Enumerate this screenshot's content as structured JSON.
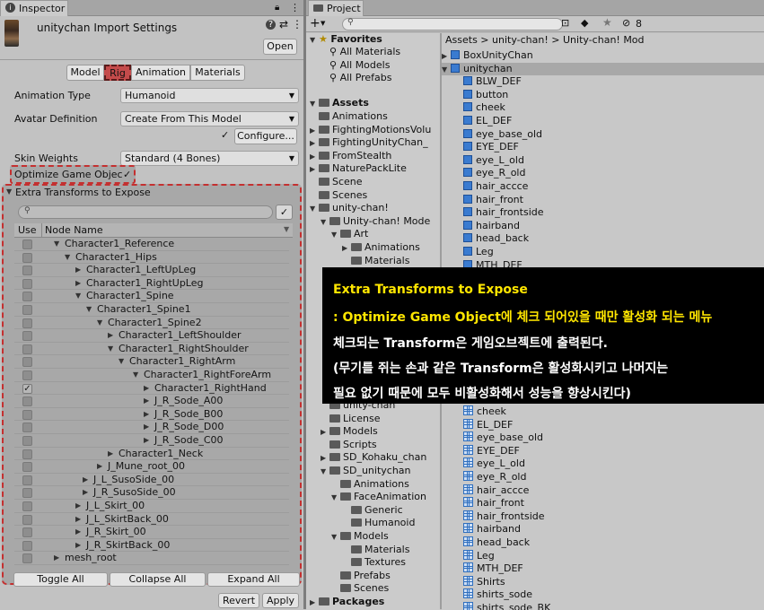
{
  "inspector": {
    "tab": "Inspector",
    "title": "unitychan Import Settings",
    "open": "Open",
    "tabs": [
      "Model",
      "Rig",
      "Animation",
      "Materials"
    ],
    "animation_type_label": "Animation Type",
    "animation_type": "Humanoid",
    "avatar_def_label": "Avatar Definition",
    "avatar_def": "Create From This Model",
    "configure": "Configure...",
    "check": "✓",
    "skin_weights_label": "Skin Weights",
    "skin_weights": "Standard (4 Bones)",
    "optimize_label": "Optimize Game Objec",
    "extra_label": "Extra Transforms to Expose",
    "col_use": "Use",
    "col_node": "Node Name",
    "nodes": [
      {
        "name": "Character1_Reference",
        "checked": false
      },
      {
        "name": "Character1_Hips",
        "checked": false
      },
      {
        "name": "Character1_LeftUpLeg",
        "checked": false
      },
      {
        "name": "Character1_RightUpLeg",
        "checked": false
      },
      {
        "name": "Character1_Spine",
        "checked": false
      },
      {
        "name": "Character1_Spine1",
        "checked": false
      },
      {
        "name": "Character1_Spine2",
        "checked": false
      },
      {
        "name": "Character1_LeftShoulder",
        "checked": false
      },
      {
        "name": "Character1_RightShoulder",
        "checked": false
      },
      {
        "name": "Character1_RightArm",
        "checked": false
      },
      {
        "name": "Character1_RightForeArm",
        "checked": false
      },
      {
        "name": "Character1_RightHand",
        "checked": true
      },
      {
        "name": "J_R_Sode_A00",
        "checked": false
      },
      {
        "name": "J_R_Sode_B00",
        "checked": false
      },
      {
        "name": "J_R_Sode_D00",
        "checked": false
      },
      {
        "name": "J_R_Sode_C00",
        "checked": false
      },
      {
        "name": "Character1_Neck",
        "checked": false
      },
      {
        "name": "J_Mune_root_00",
        "checked": false
      },
      {
        "name": "J_L_SusoSide_00",
        "checked": false
      },
      {
        "name": "J_R_SusoSide_00",
        "checked": false
      },
      {
        "name": "J_L_Skirt_00",
        "checked": false
      },
      {
        "name": "J_L_SkirtBack_00",
        "checked": false
      },
      {
        "name": "J_R_Skirt_00",
        "checked": false
      },
      {
        "name": "J_R_SkirtBack_00",
        "checked": false
      },
      {
        "name": "mesh_root",
        "checked": false
      }
    ],
    "toggle_all": "Toggle All",
    "collapse_all": "Collapse All",
    "expand_all": "Expand All",
    "revert": "Revert",
    "apply": "Apply"
  },
  "project": {
    "tab": "Project",
    "hidden_count": "8",
    "favorites": "Favorites",
    "fav_items": [
      "All Materials",
      "All Models",
      "All Prefabs"
    ],
    "assets": "Assets",
    "left_top": [
      "Animations",
      "FightingMotionsVolu",
      "FightingUnityChan_",
      "FromStealth",
      "NaturePackLite",
      "Scene",
      "Scenes",
      "unity-chan!",
      "Unity-chan! Mode",
      "Art",
      "Animations",
      "Materials"
    ],
    "left_bottom": [
      "unity-chan",
      "License",
      "Models",
      "Scripts",
      "SD_Kohaku_chan",
      "SD_unitychan",
      "Animations",
      "FaceAnimation",
      "Generic",
      "Humanoid",
      "Models",
      "Materials",
      "Textures",
      "Prefabs",
      "Scenes"
    ],
    "packages": "Packages",
    "breadcrumb": [
      "Assets",
      "unity-chan!",
      "Unity-chan! Mod"
    ],
    "right_top": [
      "BoxUnityChan",
      "unitychan",
      "BLW_DEF",
      "button",
      "cheek",
      "EL_DEF",
      "eye_base_old",
      "EYE_DEF",
      "eye_L_old",
      "eye_R_old",
      "hair_accce",
      "hair_front",
      "hair_frontside",
      "hairband",
      "head_back",
      "Leg",
      "MTH_DEF"
    ],
    "right_bottom": [
      "cheek",
      "EL_DEF",
      "eye_base_old",
      "EYE_DEF",
      "eye_L_old",
      "eye_R_old",
      "hair_accce",
      "hair_front",
      "hair_frontside",
      "hairband",
      "head_back",
      "Leg",
      "MTH_DEF",
      "Shirts",
      "shirts_sode",
      "shirts_sode_BK"
    ]
  },
  "overlay": {
    "title": "Extra Transforms to Expose",
    "line1_a": " : Optimize Game Object",
    "line1_b": "에 체크 되어있을 때만 활성화 되는 메뉴",
    "line2_a": "체크되는 ",
    "line2_b": "Transform",
    "line2_c": "은 게임오브젝트에 출력된다.",
    "line3_a": "(무기를 쥐는 손과 같은 ",
    "line3_b": "Transform",
    "line3_c": "은 활성화시키고 나머지는",
    "line4": " 필요 없기 때문에 모두 비활성화해서 성능을 향상시킨다)",
    "title_color": "#ffe600"
  }
}
